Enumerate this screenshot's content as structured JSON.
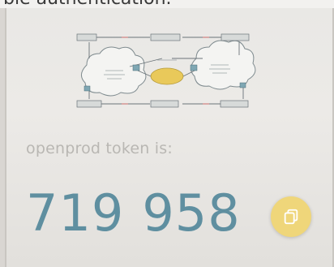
{
  "caption": "ble authentication.",
  "token": {
    "label": "openprod token is:",
    "code_part1": "719",
    "code_part2": "958"
  },
  "colors": {
    "accent": "#efd67a",
    "code": "#5f8fa0",
    "label": "#b9b7b3"
  },
  "icons": {
    "copy": "copy-icon"
  }
}
